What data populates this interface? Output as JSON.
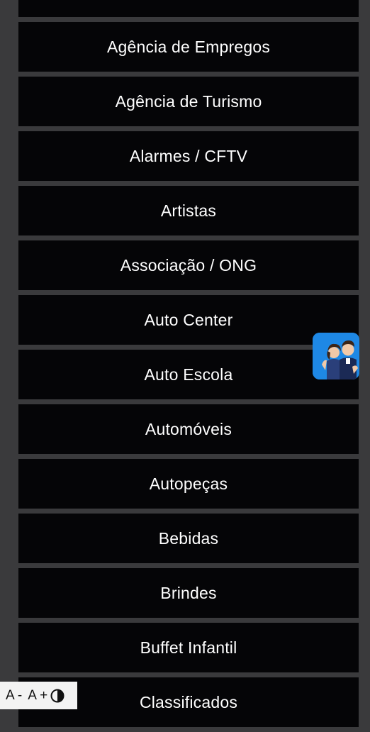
{
  "categories": [
    "",
    "Agência de Empregos",
    "Agência de Turismo",
    "Alarmes / CFTV",
    "Artistas",
    "Associação / ONG",
    "Auto Center",
    "Auto Escola",
    "Automóveis",
    "Autopeças",
    "Bebidas",
    "Brindes",
    "Buffet Infantil",
    "Classificados"
  ],
  "accessibility": {
    "decrease": "A -",
    "increase": "A +",
    "contrast_icon": "contrast-icon"
  },
  "assistant": {
    "icon": "virtual-assistant-avatars",
    "background": "#1e88e5"
  },
  "colors": {
    "page_background": "#3a3a3c",
    "item_background": "#050507",
    "item_text": "#ffffff"
  }
}
